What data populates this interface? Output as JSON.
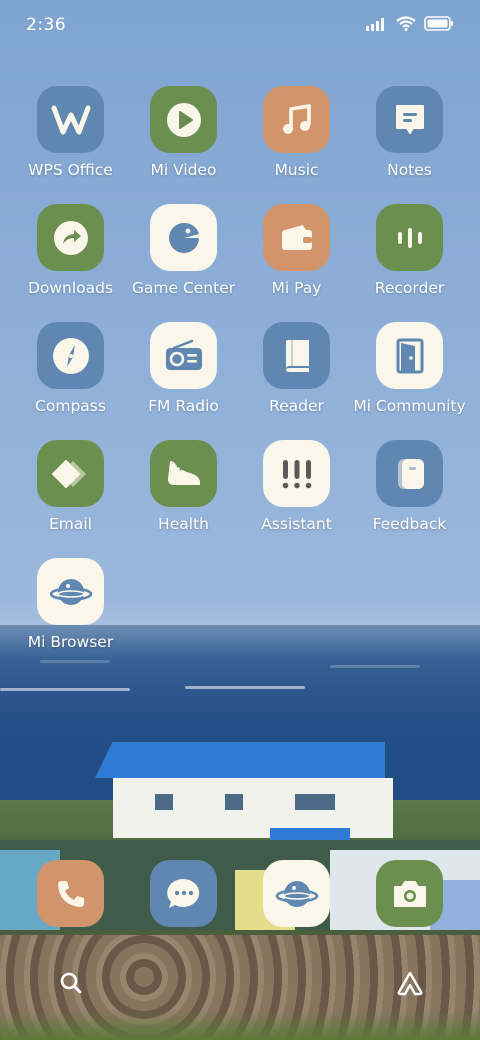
{
  "status_bar": {
    "time": "2:36",
    "icons": [
      "signal-icon",
      "wifi-icon",
      "battery-icon"
    ]
  },
  "apps": [
    {
      "label": "WPS Office",
      "icon": "wps-office-icon",
      "color": "#5f87b2"
    },
    {
      "label": "Mi Video",
      "icon": "play-icon",
      "color": "#6a8f4e"
    },
    {
      "label": "Music",
      "icon": "music-note-icon",
      "color": "#d2946b"
    },
    {
      "label": "Notes",
      "icon": "note-icon",
      "color": "#5f87b2"
    },
    {
      "label": "Downloads",
      "icon": "download-arrow-icon",
      "color": "#6a8f4e"
    },
    {
      "label": "Game Center",
      "icon": "game-pacman-icon",
      "color": "#fbf6ea"
    },
    {
      "label": "Mi Pay",
      "icon": "wallet-icon",
      "color": "#d2946b"
    },
    {
      "label": "Recorder",
      "icon": "waveform-icon",
      "color": "#6a8f4e"
    },
    {
      "label": "Compass",
      "icon": "compass-icon",
      "color": "#5f87b2"
    },
    {
      "label": "FM Radio",
      "icon": "radio-icon",
      "color": "#fbf6ea"
    },
    {
      "label": "Reader",
      "icon": "book-icon",
      "color": "#5f87b2"
    },
    {
      "label": "Mi Community",
      "icon": "door-icon",
      "color": "#fbf6ea"
    },
    {
      "label": "Email",
      "icon": "email-diamond-icon",
      "color": "#6a8f4e"
    },
    {
      "label": "Health",
      "icon": "sneaker-icon",
      "color": "#6a8f4e"
    },
    {
      "label": "Assistant",
      "icon": "exclamation-icon",
      "color": "#fbf6ea"
    },
    {
      "label": "Feedback",
      "icon": "feedback-card-icon",
      "color": "#5f87b2"
    },
    {
      "label": "Mi Browser",
      "icon": "planet-icon",
      "color": "#fbf6ea"
    }
  ],
  "dock": [
    {
      "name": "phone",
      "icon": "phone-icon",
      "color": "#d2946b"
    },
    {
      "name": "messages",
      "icon": "chat-bubble-icon",
      "color": "#5f87b2"
    },
    {
      "name": "browser",
      "icon": "planet-icon",
      "color": "#fbf6ea"
    },
    {
      "name": "camera",
      "icon": "camera-icon",
      "color": "#6a8f4e"
    }
  ],
  "bottom_bar": {
    "left_icon": "search-icon",
    "right_icon": "home-app-vault-icon"
  }
}
